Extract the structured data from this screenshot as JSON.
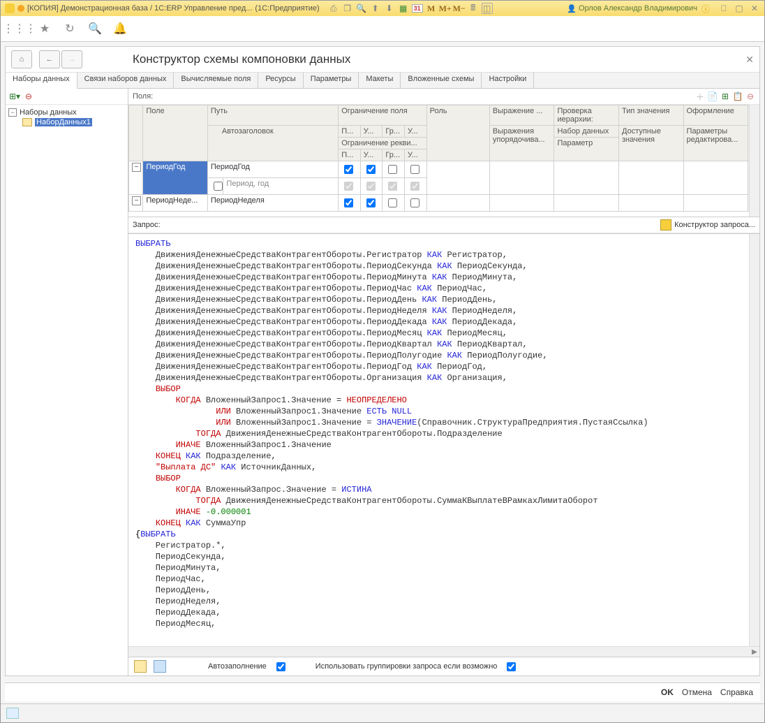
{
  "title": {
    "left": "[КОПИЯ] Демонстрационная база / 1С:ERP Управление пред...",
    "right": "(1С:Предприятие)"
  },
  "user": "Орлов Александр Владимирович",
  "topbar_icons": {
    "m": "M",
    "mplus": "M+",
    "mminus": "M−",
    "cal": "31"
  },
  "page_title": "Конструктор схемы компоновки данных",
  "tabs": [
    "Наборы данных",
    "Связи наборов данных",
    "Вычисляемые поля",
    "Ресурсы",
    "Параметры",
    "Макеты",
    "Вложенные схемы",
    "Настройки"
  ],
  "tree": {
    "root": "Наборы данных",
    "item": "НаборДанных1"
  },
  "fields_label": "Поля:",
  "grid": {
    "cols": {
      "field": "Поле",
      "path": "Путь",
      "autohdr": "Автозаголовок",
      "restr_field": "Ограничение поля",
      "restr_req": "Ограничение рекви...",
      "p": "П...",
      "u": "У...",
      "gr": "Гр...",
      "u2": "У...",
      "role": "Роль",
      "expr": "Выражение ...",
      "expr_ord": "Выражения упорядочива...",
      "hier": "Проверка иерархии:",
      "hier_set": "Набор данных",
      "hier_param": "Параметр",
      "valtype": "Тип значения",
      "avail": "Доступные значения",
      "design": "Оформление",
      "editparam": "Параметры редактирова..."
    },
    "rows": [
      {
        "field": "ПериодГод",
        "path": "ПериодГод",
        "auto": "Период, год",
        "c1": true,
        "c2": true,
        "c3": false,
        "c4": false
      },
      {
        "field": "ПериодНеде...",
        "path": "ПериодНеделя",
        "c1": true,
        "c2": true,
        "c3": false,
        "c4": false
      }
    ]
  },
  "query_label": "Запрос:",
  "query_builder_btn": "Конструктор запроса...",
  "footer": {
    "autofill": "Автозаполнение",
    "use_group": "Использовать группировки запроса если возможно"
  },
  "okbar": {
    "ok": "OK",
    "cancel": "Отмена",
    "help": "Справка"
  },
  "code": {
    "select": "ВЫБРАТЬ",
    "kak": "КАК",
    "case": "ВЫБОР",
    "when": "КОГДА",
    "then": "ТОГДА",
    "else": "ИНАЧЕ",
    "end": "КОНЕЦ",
    "or": "ИЛИ",
    "isnull": "ЕСТЬ NULL",
    "undef": "НЕОПРЕДЕЛЕНО",
    "val": "ЗНАЧЕНИЕ",
    "true": "ИСТИНА",
    "neg": "-0.000001",
    "src": "ДвиженияДенежныеСредстваКонтрагентОбороты",
    "fields": [
      [
        "Регистратор",
        "Регистратор"
      ],
      [
        "ПериодСекунда",
        "ПериодСекунда"
      ],
      [
        "ПериодМинута",
        "ПериодМинута"
      ],
      [
        "ПериодЧас",
        "ПериодЧас"
      ],
      [
        "ПериодДень",
        "ПериодДень"
      ],
      [
        "ПериодНеделя",
        "ПериодНеделя"
      ],
      [
        "ПериодДекада",
        "ПериодДекада"
      ],
      [
        "ПериодМесяц",
        "ПериодМесяц"
      ],
      [
        "ПериодКвартал",
        "ПериодКвартал"
      ],
      [
        "ПериодПолугодие",
        "ПериодПолугодие"
      ],
      [
        "ПериодГод",
        "ПериодГод"
      ],
      [
        "Организация",
        "Организация"
      ]
    ],
    "vlog1": "ВложенныйЗапрос1.Значение",
    "valref": "Справочник.СтруктураПредприятия.ПустаяСсылка",
    "podr": "Подразделение",
    "thenline": "ДвиженияДенежныеСредстваКонтрагентОбороты.Подразделение",
    "str": "\"Выплата ДС\"",
    "istochnik": "ИсточникДанных",
    "vlog": "ВложенныйЗапрос.Значение",
    "summaline": "ДвиженияДенежныеСредстваКонтрагентОбороты.СуммаКВыплатеВРамкахЛимитаОборот",
    "summaupr": "СуммаУпр",
    "tail": [
      "Регистратор.*,",
      "ПериодСекунда,",
      "ПериодМинута,",
      "ПериодЧас,",
      "ПериодДень,",
      "ПериодНеделя,",
      "ПериодДекада,",
      "ПериодМесяц,"
    ]
  }
}
